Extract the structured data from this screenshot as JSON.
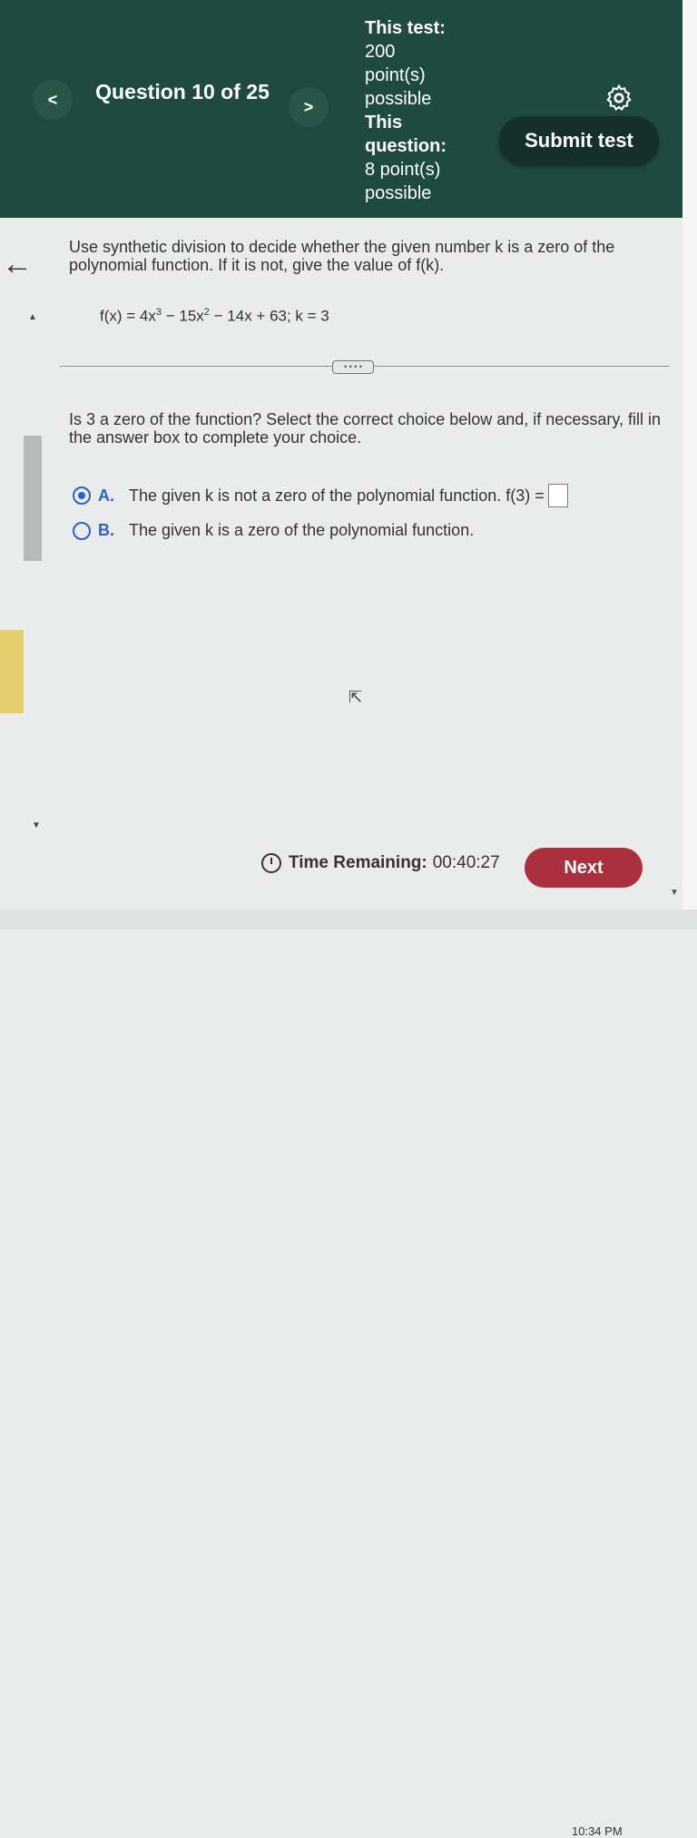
{
  "header": {
    "prev_icon": "<",
    "next_icon": ">",
    "question_label": "Question 10 of 25",
    "points_lines": [
      "This test:",
      "200",
      "point(s)",
      "possible",
      "This",
      "question:",
      "8 point(s)",
      "possible"
    ],
    "submit_label": "Submit test"
  },
  "content": {
    "instructions": "Use synthetic division to decide whether the given number k is a zero of the polynomial function. If it is not, give the value of f(k).",
    "function_parts": {
      "lead": "f(x) = 4x",
      "exp1": "3",
      "mid": " − 15x",
      "exp2": "2",
      "tail": " − 14x + 63; k = 3"
    },
    "prompt": "Is 3 a zero of the function? Select the correct choice below and, if necessary, fill in the answer box to complete your choice.",
    "choices": [
      {
        "letter": "A.",
        "text": "The given k is not a zero of the polynomial function. f(3) =",
        "selected": true
      },
      {
        "letter": "B.",
        "text": "The given k is a zero of the polynomial function.",
        "selected": false
      }
    ]
  },
  "footer": {
    "time_label": "Time Remaining:",
    "time_value": "00:40:27",
    "next_label": "Next",
    "clock": "10:34 PM"
  },
  "colors": {
    "header": "#1f4a3f",
    "accent": "#2a63c7",
    "next": "#a9303c"
  }
}
